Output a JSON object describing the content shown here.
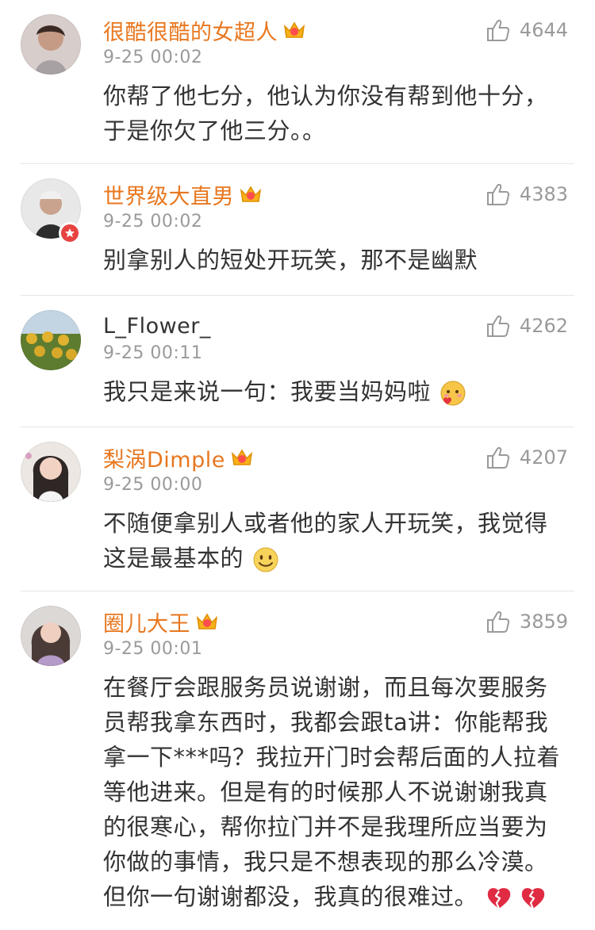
{
  "comments": [
    {
      "username": "很酷很酷的女超人",
      "time": "9-25 00:02",
      "likes": "4644",
      "text_lines": [
        "你帮了他七分，他认为你没有帮到他十分，",
        "于是你欠了他三分。。"
      ],
      "vip": true,
      "avatar_colors": [
        "#c9b3a7",
        "#7a5b4f"
      ]
    },
    {
      "username": "世界级大直男",
      "time": "9-25 00:02",
      "likes": "4383",
      "text_lines": [
        "别拿别人的短处开玩笑，那不是幽默"
      ],
      "vip": true,
      "avatar_colors": [
        "#d8d8d8",
        "#3b3b3b"
      ]
    },
    {
      "username": "L_Flower_",
      "time": "9-25 00:11",
      "likes": "4262",
      "text_lines": [
        "我只是来说一句：我要当妈妈啦"
      ],
      "vip": false,
      "avatar_colors": [
        "#b7c7d6",
        "#6d8a3a"
      ]
    },
    {
      "username": "梨涡Dimple",
      "time": "9-25 00:00",
      "likes": "4207",
      "text_lines": [
        "不随便拿别人或者他的家人开玩笑，我觉得",
        "这是最基本的"
      ],
      "vip": true,
      "avatar_colors": [
        "#e6ded6",
        "#3c3431"
      ]
    },
    {
      "username": "圈儿大王",
      "time": "9-25 00:01",
      "likes": "3859",
      "text_lines": [
        "在餐厅会跟服务员说谢谢，而且每次要服务",
        "员帮我拿东西时，我都会跟ta讲：你能帮我",
        "拿一下***吗？我拉开门时会帮后面的人拉着",
        "等他进来。但是有的时候那人不说谢谢我真",
        "的很寒心，帮你拉门并不是我理所应当要为",
        "你做的事情，我只是不想表现的那么冷漠。",
        "但你一句谢谢都没，我真的很难过。"
      ],
      "vip": true,
      "avatar_colors": [
        "#d9d6d4",
        "#5a4b46"
      ]
    }
  ],
  "colors": {
    "username": "#e8771f",
    "time": "#9a9a9a",
    "text": "#333333",
    "divider": "#e6e6e6"
  },
  "icons": {
    "like": "thumb-up-icon",
    "vip": "crown-icon",
    "emoji_1": "blush-heart-emoji",
    "emoji_2": "smile-emoji",
    "emoji_3": "broken-heart-emoji"
  }
}
